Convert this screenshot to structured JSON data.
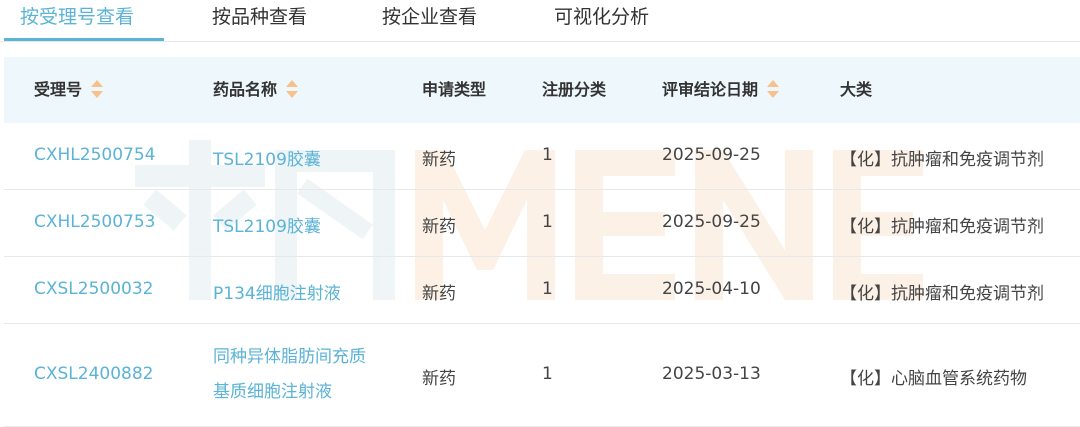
{
  "tabs": [
    {
      "label": "按受理号查看"
    },
    {
      "label": "按品种查看"
    },
    {
      "label": "按企业查看"
    },
    {
      "label": "可视化分析"
    }
  ],
  "table": {
    "headers": [
      "受理号",
      "药品名称",
      "申请类型",
      "注册分类",
      "评审结论日期",
      "大类"
    ],
    "rows": [
      {
        "accept_no": "CXHL2500754",
        "drug_name": "TSL2109胶囊",
        "app_type": "新药",
        "reg_class": "1",
        "date": "2025-09-25",
        "category": "【化】抗肿瘤和免疫调节剂"
      },
      {
        "accept_no": "CXHL2500753",
        "drug_name": "TSL2109胶囊",
        "app_type": "新药",
        "reg_class": "1",
        "date": "2025-09-25",
        "category": "【化】抗肿瘤和免疫调节剂"
      },
      {
        "accept_no": "CXSL2500032",
        "drug_name": "P134细胞注射液",
        "app_type": "新药",
        "reg_class": "1",
        "date": "2025-04-10",
        "category": "【化】抗肿瘤和免疫调节剂"
      },
      {
        "accept_no": "CXSL2400882",
        "drug_name_line1": "同种异体脂肪间充质",
        "drug_name_line2": "基质细胞注射液",
        "app_type": "新药",
        "reg_class": "1",
        "date": "2025-03-13",
        "category": "【化】心脑血管系统药物"
      }
    ]
  },
  "watermark": {
    "text": "米内MENET"
  },
  "colors": {
    "accent": "#5bb3d6",
    "header_bg": "#eef7fc",
    "sort_icon": "#f5c28c"
  }
}
